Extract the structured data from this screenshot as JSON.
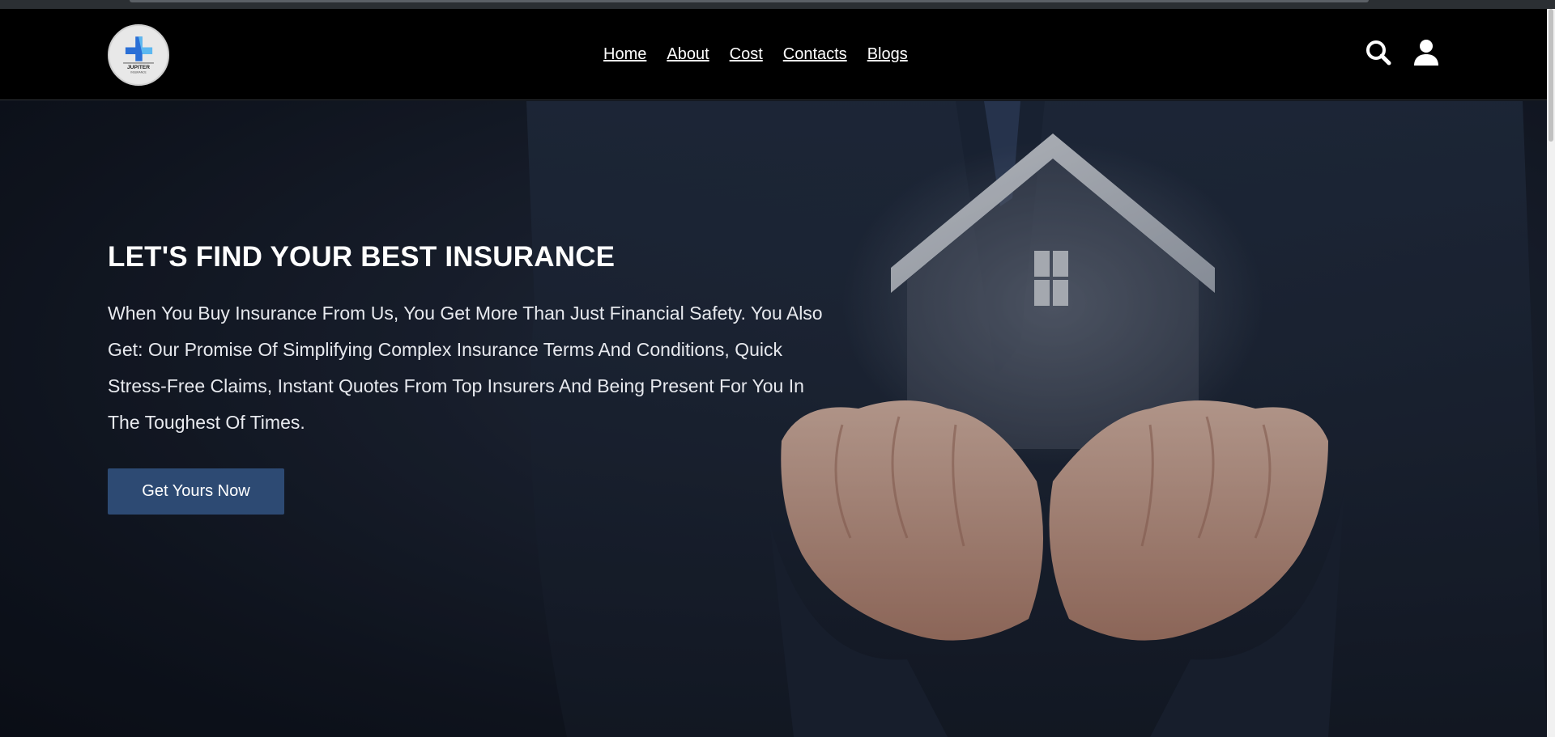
{
  "logo": {
    "brand": "JUPITER",
    "tagline": "INSURANCE",
    "ring_text": "ALWAYS BETTER CARE"
  },
  "nav": {
    "items": [
      {
        "label": "Home"
      },
      {
        "label": "About"
      },
      {
        "label": "Cost"
      },
      {
        "label": "Contacts"
      },
      {
        "label": "Blogs"
      }
    ],
    "icons": [
      "search-icon",
      "user-icon"
    ]
  },
  "hero": {
    "title": "LET'S FIND YOUR BEST INSURANCE",
    "description": "When You Buy Insurance From Us, You Get More Than Just Financial Safety. You Also Get: Our Promise Of Simplifying Complex Insurance Terms And Conditions, Quick Stress-Free Claims, Instant Quotes From Top Insurers And Being Present For You In The Toughest Of Times.",
    "cta_label": "Get Yours Now"
  },
  "colors": {
    "nav_bg": "#000000",
    "hero_bg": "#1b2230",
    "cta_bg": "#2d4a73",
    "text": "#ffffff"
  }
}
